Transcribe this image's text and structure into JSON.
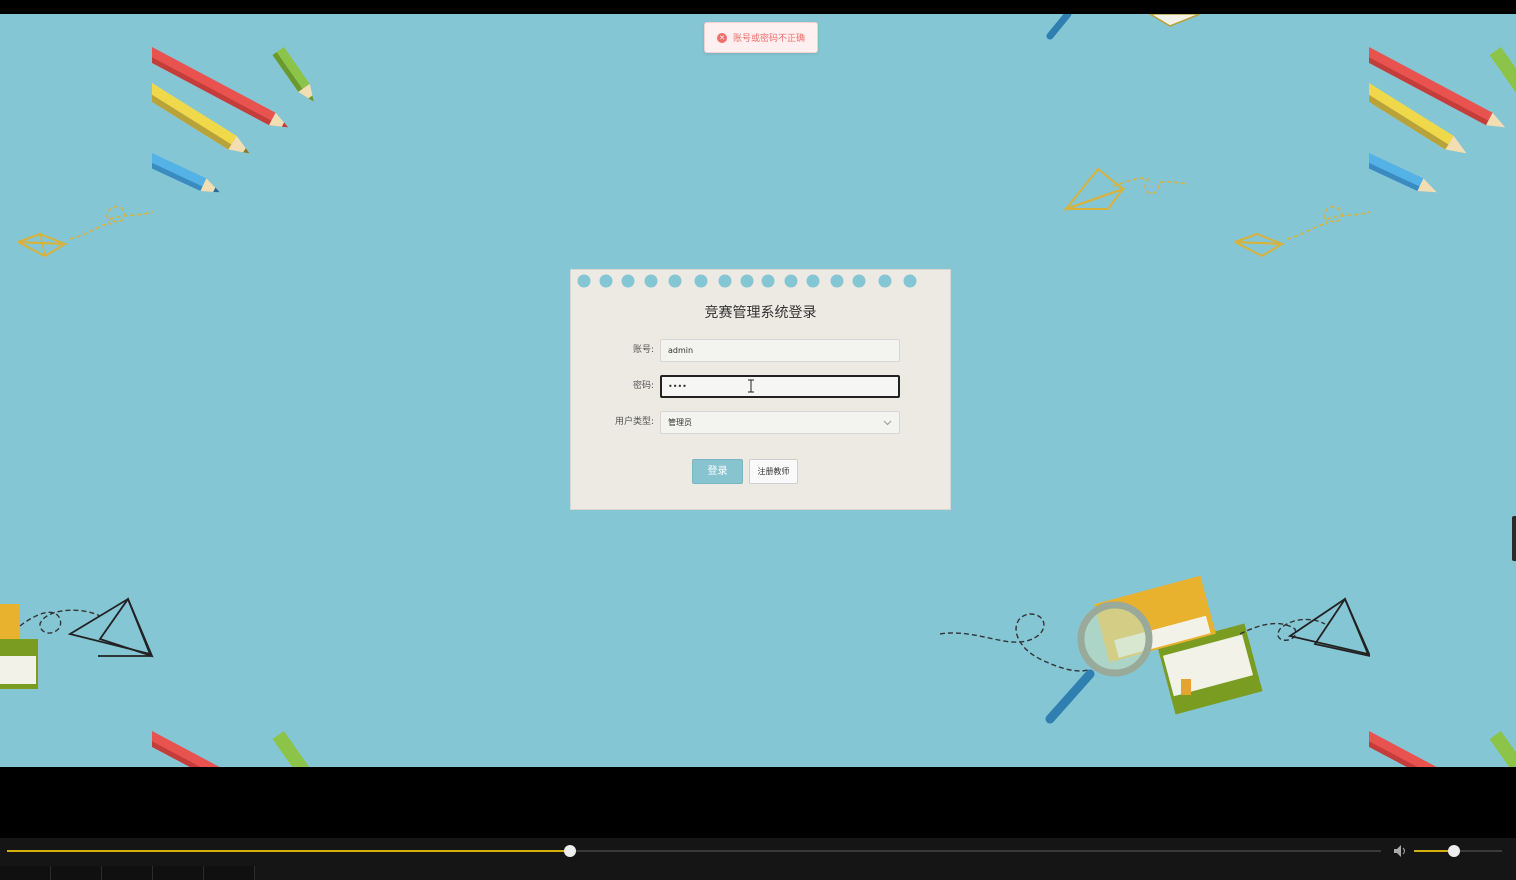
{
  "toast": {
    "icon": "error-circle-icon",
    "message": "账号或密码不正确",
    "color": "#f56c6c"
  },
  "login": {
    "title": "竞赛管理系统登录",
    "account_label": "账号:",
    "account_value": "admin",
    "password_label": "密码:",
    "password_value": "••••",
    "user_type_label": "用户类型:",
    "user_type_value": "管理员",
    "login_button": "登录",
    "register_button": "注册教师"
  },
  "player": {
    "progress": 0.41,
    "volume": 0.45,
    "accent": "#d4b10a",
    "volume_icon": "speaker-icon"
  },
  "colors": {
    "background": "#85c6d5",
    "card": "#eceae3",
    "primary_button": "#88c4d0"
  }
}
